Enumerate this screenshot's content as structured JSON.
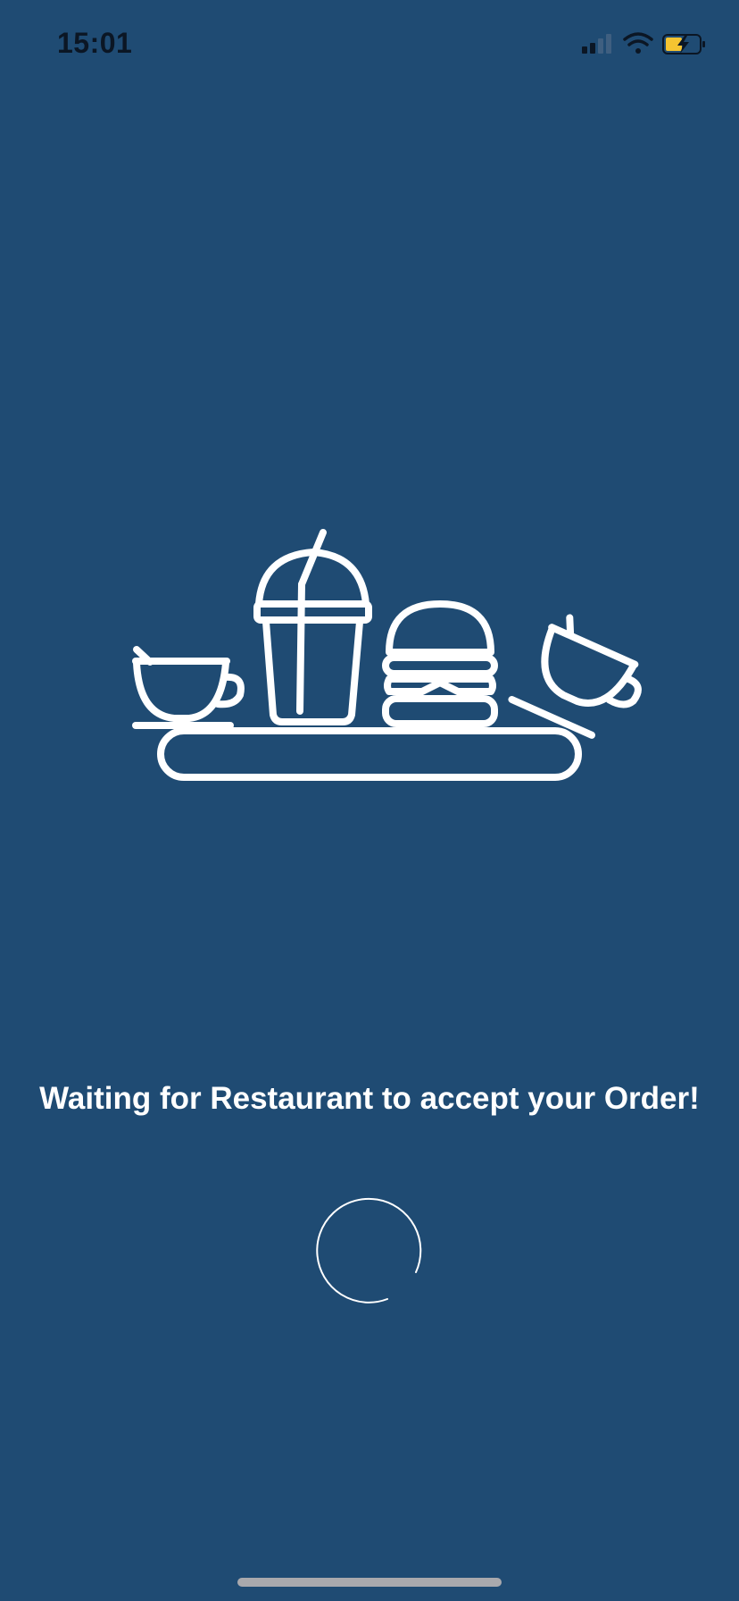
{
  "status_bar": {
    "time": "15:01",
    "icons": [
      "signal-icon",
      "wifi-icon",
      "battery-charging-icon"
    ],
    "battery_color": "#f5c431"
  },
  "illustration": {
    "items": [
      "teacup-icon",
      "drink-cup-with-straw-icon",
      "burger-icon",
      "tipped-teacup-icon",
      "tray-icon"
    ]
  },
  "main": {
    "message": "Waiting for Restaurant to accept your Order!"
  },
  "spinner": {
    "icon": "loading-spinner-icon"
  },
  "colors": {
    "background": "#1f4b73",
    "foreground": "#ffffff",
    "home_indicator": "#a9a9ad"
  }
}
